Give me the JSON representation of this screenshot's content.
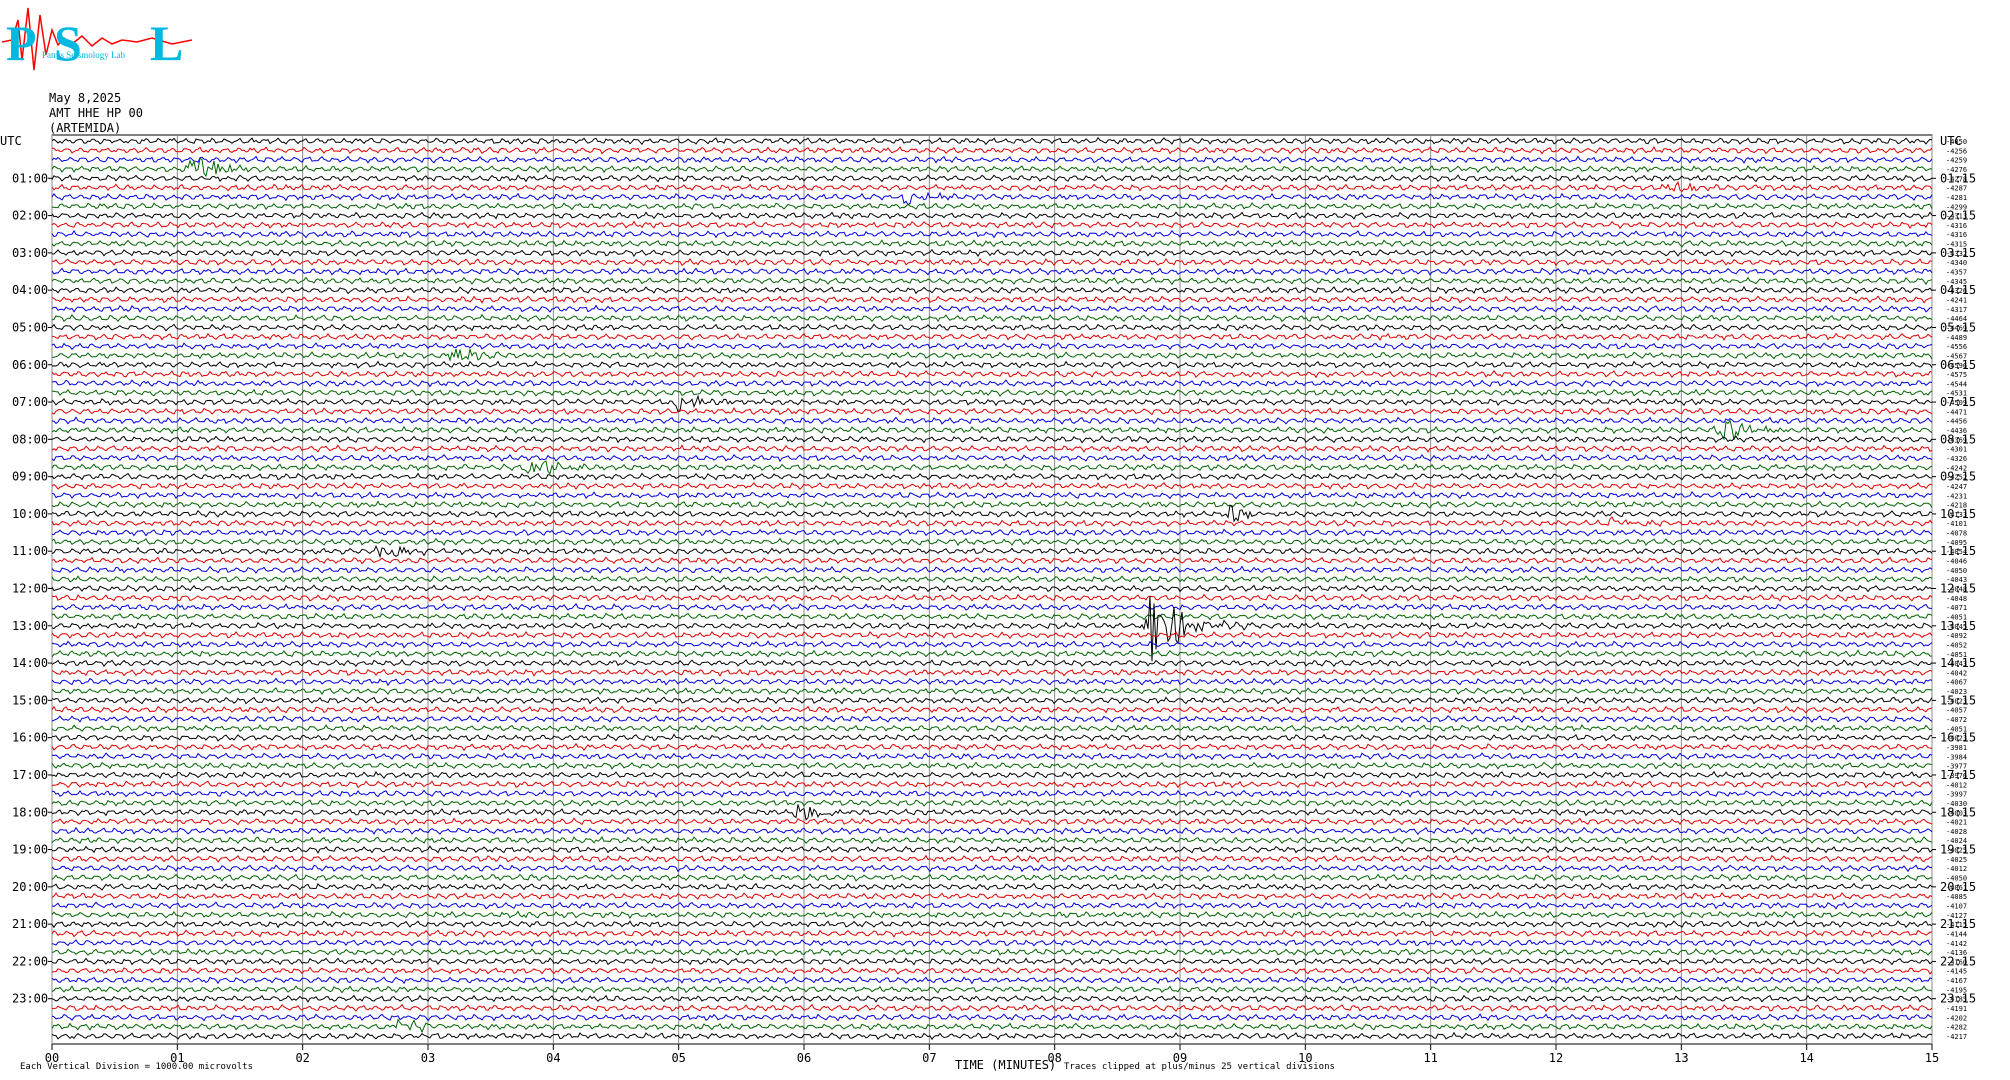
{
  "logo": {
    "letters": "PSL",
    "text": "Patras Seismology Lab",
    "colors": {
      "letters": "#00b8e0",
      "trace": "#ff0000"
    }
  },
  "header": {
    "date": "May 8,2025",
    "station": "AMT HHE HP 00",
    "location": "(ARTEMIDA)"
  },
  "chart_data": {
    "type": "line",
    "subtype": "helicorder",
    "xlabel": "TIME (MINUTES)",
    "xlim": [
      0,
      15
    ],
    "x_ticks": [
      "00",
      "01",
      "02",
      "03",
      "04",
      "05",
      "06",
      "07",
      "08",
      "09",
      "10",
      "11",
      "12",
      "13",
      "14",
      "15"
    ],
    "left_axis_title": "UTC",
    "right_axis_title": "UTC",
    "left_labels": [
      "01:00",
      "02:00",
      "03:00",
      "04:00",
      "05:00",
      "06:00",
      "07:00",
      "08:00",
      "09:00",
      "10:00",
      "11:00",
      "12:00",
      "13:00",
      "14:00",
      "15:00",
      "16:00",
      "17:00",
      "18:00",
      "19:00",
      "20:00",
      "21:00",
      "22:00",
      "23:00"
    ],
    "right_labels": [
      "01:15",
      "02:15",
      "03:15",
      "04:15",
      "05:15",
      "06:15",
      "07:15",
      "08:15",
      "09:15",
      "10:15",
      "11:15",
      "12:15",
      "13:15",
      "14:15",
      "15:15",
      "16:15",
      "17:15",
      "18:15",
      "19:15",
      "20:15",
      "21:15",
      "22:15",
      "23:15"
    ],
    "trace_colors": [
      "#000000",
      "#e00000",
      "#0000e0",
      "#006400"
    ],
    "row_offsets": [
      "-4050",
      "-4256",
      "-4259",
      "-4276",
      "-4278",
      "-4287",
      "-4281",
      "-4299",
      "-4313",
      "-4316",
      "-4316",
      "-4315",
      "-4332",
      "-4340",
      "-4357",
      "-4345",
      "-4326",
      "-4241",
      "-4317",
      "-4464",
      "-4469",
      "-4489",
      "-4556",
      "-4567",
      "-4596",
      "-4575",
      "-4544",
      "-4531",
      "-4509",
      "-4471",
      "-4456",
      "-4436",
      "-4369",
      "-4301",
      "-4326",
      "-4242",
      "-4252",
      "-4247",
      "-4231",
      "-4218",
      "-4133",
      "-4101",
      "-4078",
      "-4095",
      "-4054",
      "-4046",
      "-4050",
      "-4043",
      "-4048",
      "-4048",
      "-4071",
      "-4051",
      "-4045",
      "-4092",
      "-4052",
      "-4051",
      "-4043",
      "-4042",
      "-4067",
      "-4023",
      "-4023",
      "-4057",
      "-4072",
      "-4051",
      "-4023",
      "-3981",
      "-3984",
      "-3977",
      "-3976",
      "-4012",
      "-3997",
      "-4030",
      "-4003",
      "-4021",
      "-4028",
      "-4024",
      "-4025",
      "-4025",
      "-4012",
      "-4050",
      "-4061",
      "-4085",
      "-4107",
      "-4127",
      "-4115",
      "-4144",
      "-4142",
      "-4136",
      "-4160",
      "-4145",
      "-4167",
      "-4195",
      "-4185",
      "-4191",
      "-4202",
      "-4282",
      "-4217"
    ],
    "events": [
      {
        "row": 3,
        "minute": 1.1,
        "amplitude": 2.0
      },
      {
        "row": 6,
        "minute": 6.8,
        "amplitude": 0.8
      },
      {
        "row": 5,
        "minute": 12.9,
        "amplitude": 0.7
      },
      {
        "row": 23,
        "minute": 3.2,
        "amplitude": 0.9
      },
      {
        "row": 28,
        "minute": 5.0,
        "amplitude": 1.0
      },
      {
        "row": 31,
        "minute": 13.3,
        "amplitude": 1.6
      },
      {
        "row": 35,
        "minute": 3.8,
        "amplitude": 1.2
      },
      {
        "row": 40,
        "minute": 9.4,
        "amplitude": 1.0
      },
      {
        "row": 41,
        "minute": 12.4,
        "amplitude": 0.7
      },
      {
        "row": 44,
        "minute": 2.6,
        "amplitude": 0.9
      },
      {
        "row": 52,
        "minute": 8.75,
        "amplitude": 5.0
      },
      {
        "row": 72,
        "minute": 5.95,
        "amplitude": 1.1
      },
      {
        "row": 95,
        "minute": 2.75,
        "amplitude": 0.9
      }
    ],
    "footer_scale": "Each Vertical Division = 1000.00 microvolts",
    "footer_clip": "Traces clipped at plus/minus 25 vertical divisions"
  }
}
